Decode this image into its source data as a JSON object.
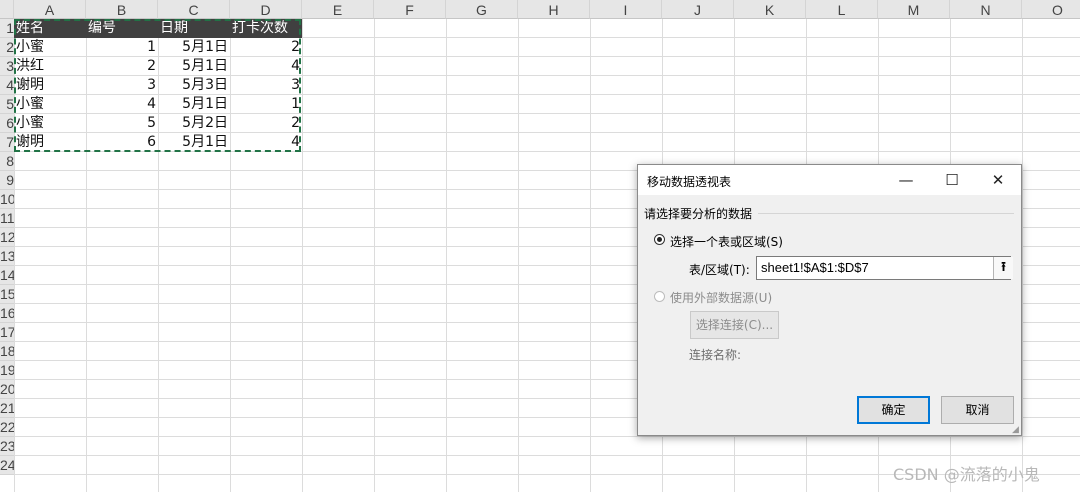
{
  "columns": [
    "A",
    "B",
    "C",
    "D",
    "E",
    "F",
    "G",
    "H",
    "I",
    "J",
    "K",
    "L",
    "M",
    "N",
    "O"
  ],
  "rows": [
    "1",
    "2",
    "3",
    "4",
    "5",
    "6",
    "7",
    "8",
    "9",
    "10",
    "11",
    "12",
    "13",
    "14",
    "15",
    "16",
    "17",
    "18",
    "19",
    "20",
    "21",
    "22",
    "23",
    "24"
  ],
  "table": {
    "headers": [
      "姓名",
      "编号",
      "日期",
      "打卡次数"
    ],
    "rows": [
      [
        "小蜜",
        "1",
        "5月1日",
        "2"
      ],
      [
        "洪红",
        "2",
        "5月1日",
        "4"
      ],
      [
        "谢明",
        "3",
        "5月3日",
        "3"
      ],
      [
        "小蜜",
        "4",
        "5月1日",
        "1"
      ],
      [
        "小蜜",
        "5",
        "5月2日",
        "2"
      ],
      [
        "谢明",
        "6",
        "5月1日",
        "4"
      ]
    ]
  },
  "dialog": {
    "title": "移动数据透视表",
    "minimize": "—",
    "maximize": "☐",
    "close": "✕",
    "section_label": "请选择要分析的数据",
    "option_table": "选择一个表或区域(S)",
    "range_label": "表/区域(T):",
    "range_value": "sheet1!$A$1:$D$7",
    "collapse_icon": "⭱",
    "option_external": "使用外部数据源(U)",
    "choose_connection": "选择连接(C)...",
    "connection_name_label": "连接名称:",
    "ok": "确定",
    "cancel": "取消"
  },
  "watermark": "CSDN @流落的小鬼"
}
